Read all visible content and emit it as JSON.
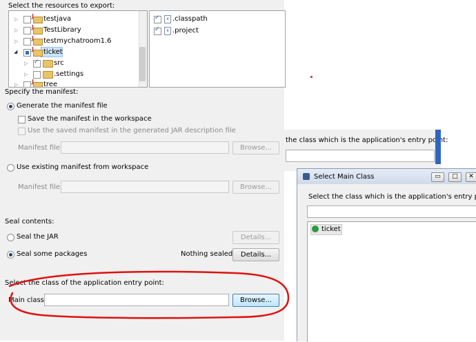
{
  "export_panel": {
    "resources_label": "Select the resources to export:",
    "tree": [
      {
        "label": "testjava"
      },
      {
        "label": "TestLibrary"
      },
      {
        "label": "testmychatroom1.6"
      },
      {
        "label": "ticket"
      },
      {
        "label": "src"
      },
      {
        "label": ".settings"
      },
      {
        "label": "tree"
      }
    ],
    "files": [
      {
        "label": ".classpath",
        "icon": "x"
      },
      {
        "label": ".project",
        "icon": "x"
      }
    ]
  },
  "manifest": {
    "title": "Specify the manifest:",
    "generate_label": "Generate the manifest file",
    "save_label": "Save the manifest in the workspace",
    "reuse_label": "Use the saved manifest in the generated JAR description file",
    "manifest_file_label": "Manifest file:",
    "browse_label": "Browse...",
    "existing_label": "Use existing manifest from workspace",
    "manifest_file_label2": "Manifest file:",
    "browse_label2": "Browse..."
  },
  "seal": {
    "title": "Seal contents:",
    "seal_jar_label": "Seal the JAR",
    "details_label": "Details...",
    "seal_packages_label": "Seal some packages",
    "nothing_sealed": "Nothing sealed",
    "details_label2": "Details..."
  },
  "entry": {
    "title": "Select the class of the application entry point:",
    "main_class_label": "Main class:",
    "main_class_value": "",
    "browse_label": "Browse..."
  },
  "bg_dialog": {
    "prompt": "the class which is the application's entry point:"
  },
  "select_main_class": {
    "title": "Select Main Class",
    "minimize": "▭",
    "maximize": "□",
    "close": "✕",
    "prompt": "Select the class which is the application's entry point:",
    "search_value": "",
    "results": [
      {
        "label": "ticket"
      }
    ]
  },
  "colors": {
    "annotation": "#e01010",
    "panel": "#f0f0f0"
  }
}
